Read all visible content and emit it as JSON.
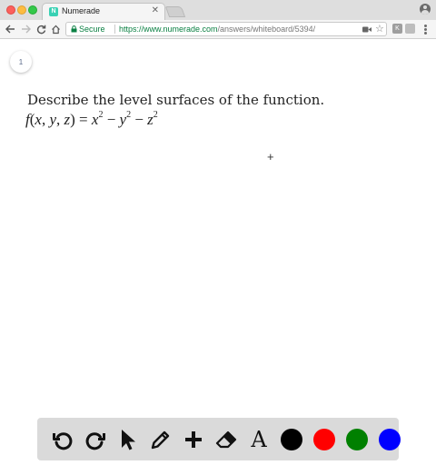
{
  "browser": {
    "tab_title": "Numerade",
    "tab_favicon": "N",
    "secure_label": "Secure",
    "url_host": "https://www.numerade.com",
    "url_path": "/answers/whiteboard/5394/"
  },
  "page": {
    "page_number": "1",
    "question": "Describe the level surfaces of the function.",
    "formula": {
      "f": "f",
      "lparen": "(",
      "x": "x",
      "c1": ",",
      "y": "y",
      "c2": ",",
      "z": "z",
      "rparen": ")",
      "eq": " = ",
      "t1_base": "x",
      "t1_exp": "2",
      "minus1": " − ",
      "t2_base": "y",
      "t2_exp": "2",
      "minus2": " − ",
      "t3_base": "z",
      "t3_exp": "2"
    }
  },
  "toolbar": {
    "tools": [
      "undo-icon",
      "redo-icon",
      "pointer-icon",
      "pencil-icon",
      "plus-icon",
      "eraser-icon",
      "text-icon"
    ],
    "text_tool_label": "A",
    "colors": [
      "#000000",
      "#ff0000",
      "#008000",
      "#0000ff"
    ]
  },
  "colors": {
    "secure_green": "#0b8043",
    "numerade_teal": "#39d1b4"
  }
}
